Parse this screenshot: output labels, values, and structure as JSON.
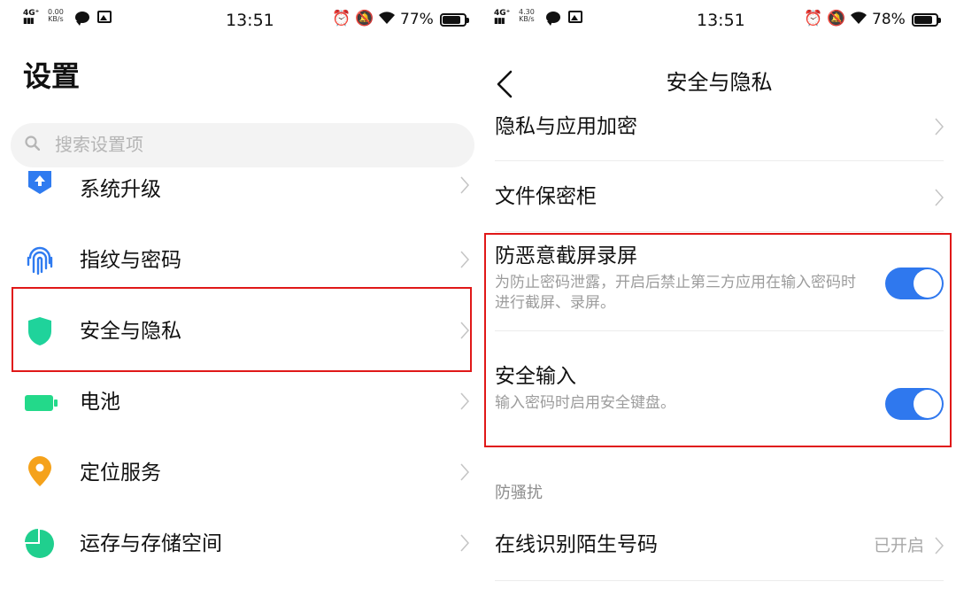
{
  "left_phone": {
    "status": {
      "net": "4G⁺",
      "speed_value": "0.00",
      "speed_unit": "KB/s",
      "time": "13:51",
      "battery_pct": "77%",
      "battery_level": 0.77
    },
    "title": "设置",
    "search_placeholder": "搜索设置项",
    "items": [
      {
        "label": "系统升级",
        "icon": "system-update-icon",
        "color": "#2f7bf0"
      },
      {
        "label": "指纹与密码",
        "icon": "fingerprint-icon",
        "color": "#2f7bf0"
      },
      {
        "label": "安全与隐私",
        "icon": "shield-icon",
        "color": "#1fd39b"
      },
      {
        "label": "电池",
        "icon": "battery-icon",
        "color": "#23d98a"
      },
      {
        "label": "定位服务",
        "icon": "location-pin-icon",
        "color": "#f5a21b"
      },
      {
        "label": "运存与存储空间",
        "icon": "storage-pie-icon",
        "color": "#20cf8e"
      }
    ]
  },
  "right_phone": {
    "status": {
      "net": "4G⁺",
      "speed_value": "4.30",
      "speed_unit": "KB/s",
      "time": "13:51",
      "battery_pct": "78%",
      "battery_level": 0.78
    },
    "title": "安全与隐私",
    "rows": [
      {
        "title": "隐私与应用加密"
      },
      {
        "title": "文件保密柜"
      },
      {
        "title": "防恶意截屏录屏",
        "subtitle": "为防止密码泄露，开启后禁止第三方应用在输入密码时进行截屏、录屏。",
        "toggle_on": true
      },
      {
        "title": "安全输入",
        "subtitle": "输入密码时启用安全键盘。",
        "toggle_on": true
      }
    ],
    "section_header": "防骚扰",
    "stranger_row": {
      "title": "在线识别陌生号码",
      "value": "已开启"
    }
  },
  "colors": {
    "highlight": "#e01818",
    "toggle_on": "#2f78ee"
  }
}
